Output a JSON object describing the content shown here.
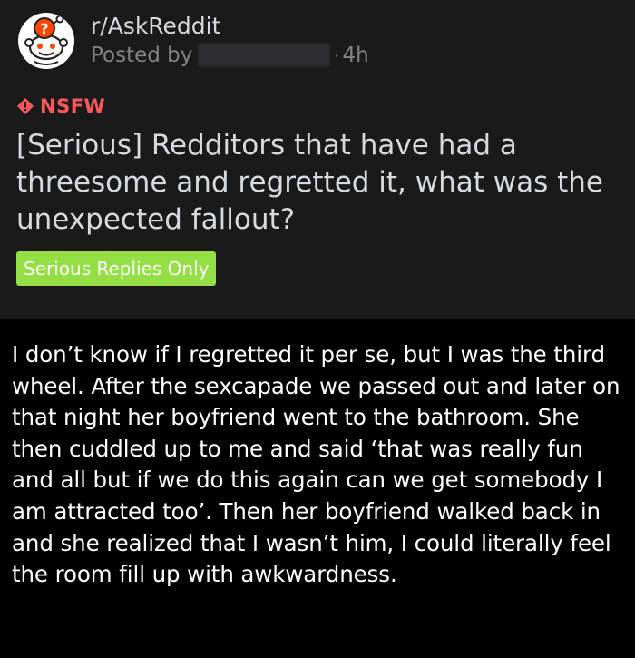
{
  "post": {
    "subreddit": "r/AskReddit",
    "posted_by_label": "Posted by",
    "time_separator": "·",
    "time": "4h",
    "nsfw_label": "NSFW",
    "title": "[Serious] Redditors that have had a threesome and regretted it, what was the unexpected fallout?",
    "flair": "Serious Replies Only"
  },
  "comment": {
    "body": "I don’t know if I regretted it per se, but I was the third wheel. After the sexcapade we passed out and later on that night her boyfriend went to the bathroom. She then cuddled up to me and said ‘that was really fun and all but if we do this again can we get somebody I am attracted too’. Then her boyfriend walked back in and she realized that I wasn’t him, I could literally feel the room fill up with awkwardness."
  },
  "icons": {
    "subreddit_avatar": "askreddit-snoo-icon",
    "nsfw": "nsfw-diamond-icon"
  },
  "colors": {
    "card_background": "#1a1a1b",
    "nsfw_red": "#ff585b",
    "flair_green": "#94e044",
    "text_primary": "#d7dadc",
    "text_muted": "#818384"
  }
}
